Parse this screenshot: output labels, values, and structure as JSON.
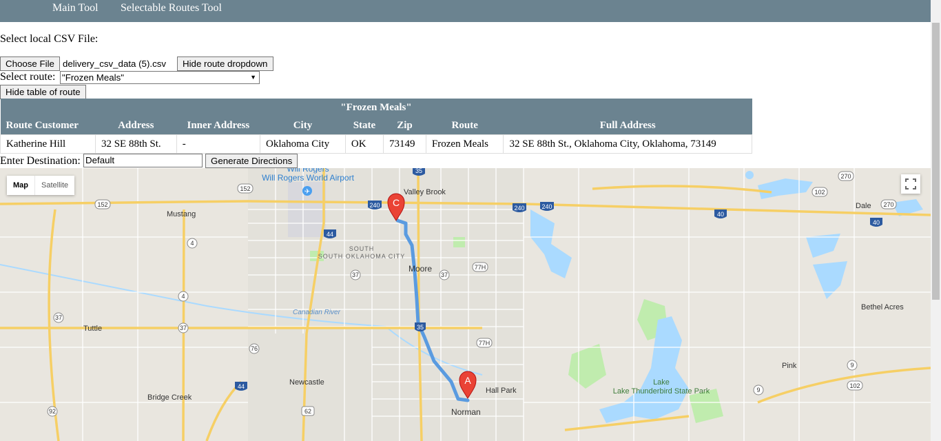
{
  "nav": {
    "items": [
      "Main Tool",
      "Selectable Routes Tool"
    ]
  },
  "csv": {
    "label": "Select local CSV File:",
    "choose_file_label": "Choose File",
    "file_name": "delivery_csv_data (5).csv",
    "hide_dropdown_label": "Hide route dropdown"
  },
  "route_select": {
    "label": "Select route:",
    "value": "\"Frozen Meals\""
  },
  "hide_table_label": "Hide table of route",
  "table": {
    "title": "\"Frozen Meals\"",
    "headers": [
      "Route Customer",
      "Address",
      "Inner Address",
      "City",
      "State",
      "Zip",
      "Route",
      "Full Address"
    ],
    "rows": [
      [
        "Katherine Hill",
        "32 SE 88th St.",
        "-",
        "Oklahoma City",
        "OK",
        "73149",
        "Frozen Meals",
        "32 SE 88th St., Oklahoma City, Oklahoma, 73149"
      ]
    ]
  },
  "destination": {
    "label": "Enter Destination:",
    "value": "Default",
    "generate_label": "Generate Directions"
  },
  "map": {
    "type_options": [
      "Map",
      "Satellite"
    ],
    "selected_type": "Map",
    "places": [
      "Will Rogers World Airport",
      "Valley Brook",
      "Mustang",
      "SOUTH OKLAHOMA CITY",
      "Moore",
      "Tuttle",
      "Newcastle",
      "Bridge Creek",
      "Hall Park",
      "Norman",
      "Lake Thunderbird State Park",
      "Dale",
      "Bethel Acres",
      "Pink",
      "Canadian River"
    ],
    "shields": [
      "35",
      "152",
      "152",
      "240",
      "240",
      "240",
      "40",
      "40",
      "44",
      "4",
      "4",
      "37",
      "37",
      "37",
      "37",
      "77H",
      "77H",
      "35",
      "76",
      "44",
      "62",
      "92",
      "9",
      "9",
      "102",
      "102",
      "270",
      "270"
    ],
    "markers": [
      "A",
      "C"
    ],
    "colors": {
      "water": "#aadaff",
      "park": "#c0ecae",
      "route": "#5a9be0",
      "highway": "#f6cf65",
      "marker": "#ea4335"
    }
  }
}
